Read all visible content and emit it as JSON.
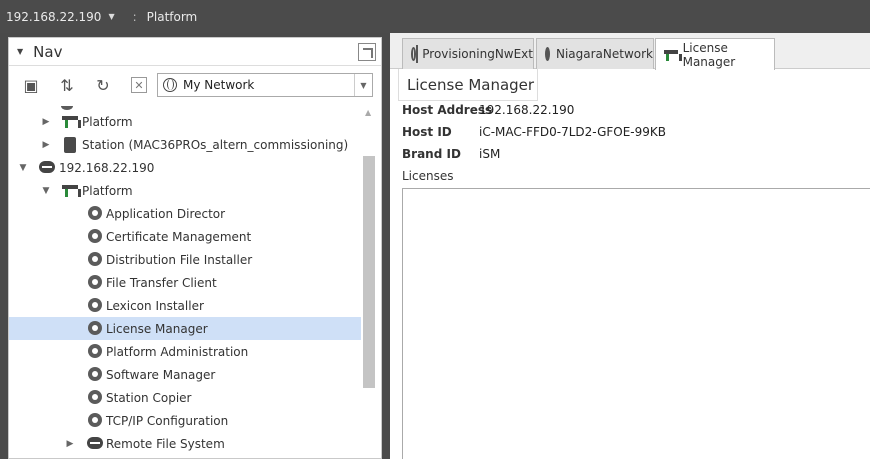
{
  "topbar": {
    "host": "192.168.22.190",
    "separator": ":",
    "crumb": "Platform"
  },
  "nav": {
    "title": "Nav",
    "network_select": "My Network",
    "tree": [
      {
        "label": "Platform",
        "icon": "platform-icon",
        "indent": 1,
        "twisty": "right"
      },
      {
        "label": "Station (MAC36PROs_altern_commissioning)",
        "icon": "station-icon",
        "indent": 1,
        "twisty": "right"
      },
      {
        "label": "192.168.22.190",
        "icon": "host-icon",
        "indent": 0,
        "twisty": "down"
      },
      {
        "label": "Platform",
        "icon": "platform-icon",
        "indent": 1,
        "twisty": "down"
      },
      {
        "label": "Application Director",
        "icon": "application-director-icon",
        "indent": 2
      },
      {
        "label": "Certificate Management",
        "icon": "certificate-icon",
        "indent": 2
      },
      {
        "label": "Distribution File Installer",
        "icon": "distribution-icon",
        "indent": 2
      },
      {
        "label": "File Transfer Client",
        "icon": "file-transfer-icon",
        "indent": 2
      },
      {
        "label": "Lexicon Installer",
        "icon": "lexicon-icon",
        "indent": 2
      },
      {
        "label": "License Manager",
        "icon": "license-icon",
        "indent": 2,
        "selected": true
      },
      {
        "label": "Platform Administration",
        "icon": "wrench-icon",
        "indent": 2
      },
      {
        "label": "Software Manager",
        "icon": "software-icon",
        "indent": 2
      },
      {
        "label": "Station Copier",
        "icon": "copier-icon",
        "indent": 2
      },
      {
        "label": "TCP/IP Configuration",
        "icon": "network-icon",
        "indent": 2
      },
      {
        "label": "Remote File System",
        "icon": "drive-icon",
        "indent": 2,
        "twisty": "right"
      }
    ]
  },
  "tabs": [
    {
      "label": "ProvisioningNwExt",
      "icon": "provisioning-icon"
    },
    {
      "label": "NiagaraNetwork",
      "icon": "niagara-network-icon"
    },
    {
      "label": "License Manager",
      "icon": "license-manager-icon",
      "active": true
    }
  ],
  "content": {
    "title": "License Manager",
    "host_address_label": "Host Address",
    "host_address": "192.168.22.190",
    "host_id_label": "Host ID",
    "host_id": "iC-MAC-FFD0-7LD2-GFOE-99KB",
    "brand_id_label": "Brand ID",
    "brand_id": "iSM",
    "licenses_label": "Licenses"
  }
}
